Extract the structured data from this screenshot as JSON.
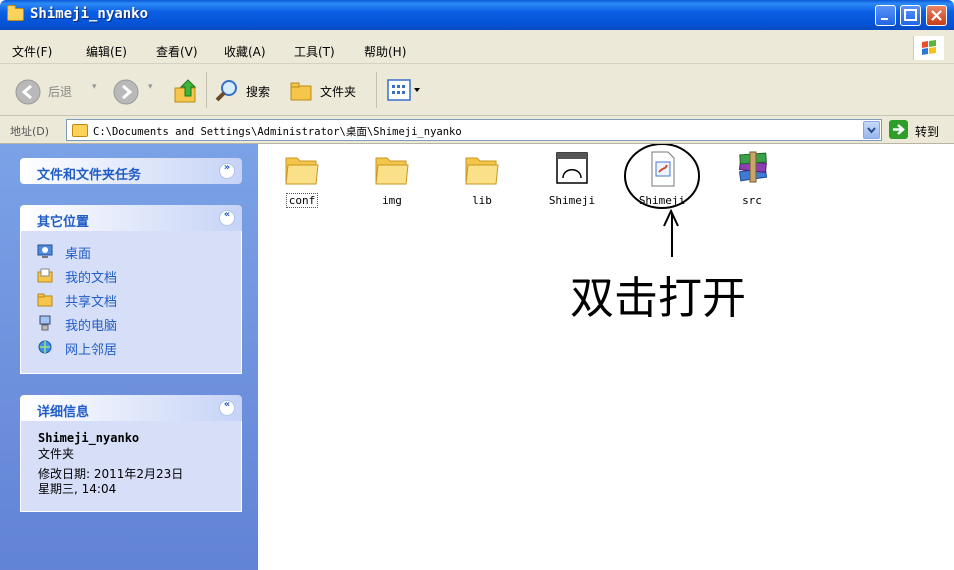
{
  "window": {
    "title": "Shimeji_nyanko"
  },
  "menu": [
    "文件(F)",
    "编辑(E)",
    "查看(V)",
    "收藏(A)",
    "工具(T)",
    "帮助(H)"
  ],
  "toolbar": {
    "back": "后退",
    "search": "搜索",
    "folders": "文件夹"
  },
  "address": {
    "label": "地址(D)",
    "path": "C:\\Documents and Settings\\Administrator\\桌面\\Shimeji_nyanko",
    "go": "转到"
  },
  "tasks": {
    "file_tasks": {
      "title": "文件和文件夹任务"
    },
    "other_places": {
      "title": "其它位置",
      "items": [
        {
          "label": "桌面",
          "icon": "desktop-icon"
        },
        {
          "label": "我的文档",
          "icon": "my-documents-icon"
        },
        {
          "label": "共享文档",
          "icon": "shared-documents-icon"
        },
        {
          "label": "我的电脑",
          "icon": "my-computer-icon"
        },
        {
          "label": "网上邻居",
          "icon": "network-places-icon"
        }
      ]
    },
    "details": {
      "title": "详细信息",
      "name": "Shimeji_nyanko",
      "type": "文件夹",
      "modified_label": "修改日期: 2011年2月23日",
      "modified_time": "星期三, 14:04"
    }
  },
  "files": [
    {
      "name": "conf",
      "icon": "folder-icon"
    },
    {
      "name": "img",
      "icon": "folder-icon"
    },
    {
      "name": "lib",
      "icon": "folder-icon"
    },
    {
      "name": "Shimeji",
      "icon": "executable-icon"
    },
    {
      "name": "Shimeji",
      "icon": "jar-file-icon"
    },
    {
      "name": "src",
      "icon": "winrar-archive-icon"
    }
  ],
  "annotation": {
    "text": "双击打开"
  }
}
